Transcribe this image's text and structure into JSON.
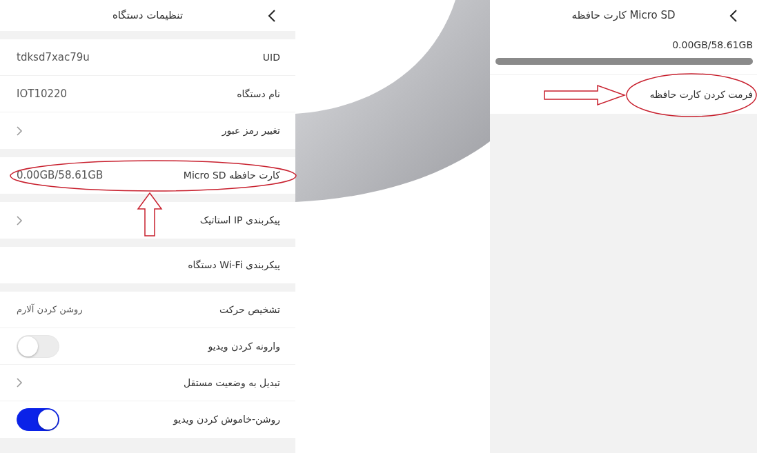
{
  "device_settings": {
    "title": "تنظیمات دستگاه",
    "groups": [
      [
        {
          "kind": "value",
          "label": "UID",
          "value": "tdksd7xac79u"
        },
        {
          "kind": "value",
          "label": "نام دستگاه",
          "value": "IOT10220"
        },
        {
          "kind": "link",
          "label": "تغییر رمز عبور"
        }
      ],
      [
        {
          "kind": "value",
          "label": "کارت حافظه Micro SD",
          "value": "0.00GB/58.61GB"
        }
      ],
      [
        {
          "kind": "link",
          "label": "پیکربندی IP استاتیک"
        }
      ],
      [
        {
          "kind": "plain",
          "label": "پیکربندی Wi-Fi دستگاه"
        }
      ],
      [
        {
          "kind": "value",
          "label": "تشخیص حرکت",
          "value": "روشن کردن آلارم"
        },
        {
          "kind": "toggle",
          "label": "وارونه کردن ویدیو",
          "on": false
        },
        {
          "kind": "link",
          "label": "تبدیل به وضعیت مستقل"
        },
        {
          "kind": "toggle",
          "label": "روشن-خاموش کردن ویدیو",
          "on": true
        }
      ]
    ]
  },
  "micro_sd": {
    "title": "کارت حافظه Micro SD",
    "usage": "0.00GB/58.61GB",
    "level": 0,
    "format_action": "فرمت کردن کارت حافظه"
  }
}
